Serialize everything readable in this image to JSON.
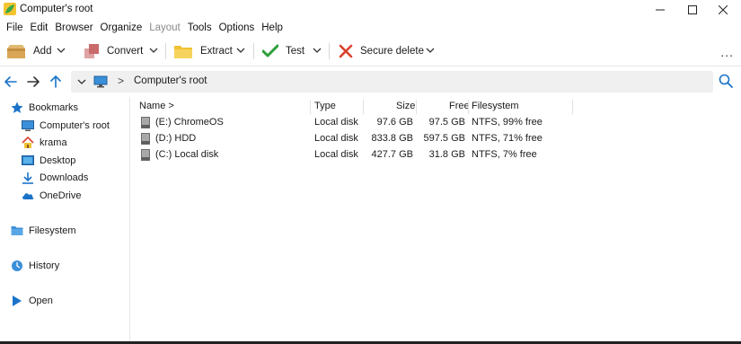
{
  "window": {
    "title": "Computer's root",
    "controls": [
      "minimize-icon",
      "maximize-icon",
      "close-icon"
    ]
  },
  "menu": [
    {
      "label": "File",
      "enabled": true
    },
    {
      "label": "Edit",
      "enabled": true
    },
    {
      "label": "Browser",
      "enabled": true
    },
    {
      "label": "Organize",
      "enabled": true
    },
    {
      "label": "Layout",
      "enabled": false
    },
    {
      "label": "Tools",
      "enabled": true
    },
    {
      "label": "Options",
      "enabled": true
    },
    {
      "label": "Help",
      "enabled": true
    }
  ],
  "toolbar": {
    "add": {
      "label": "Add",
      "icon": "archive-add-icon"
    },
    "convert": {
      "label": "Convert",
      "icon": "convert-icon"
    },
    "extract": {
      "label": "Extract",
      "icon": "folder-extract-icon"
    },
    "test": {
      "label": "Test",
      "icon": "checkmark-icon"
    },
    "secure_delete": {
      "label": "Secure delete",
      "icon": "x-delete-icon"
    },
    "more": "..."
  },
  "navigation": {
    "back_icon": "arrow-left-icon",
    "forward_icon": "arrow-right-icon",
    "up_icon": "arrow-up-icon",
    "separator": ">",
    "location": "Computer's root",
    "search_icon": "search-icon"
  },
  "sidebar": {
    "bookmarks": {
      "label": "Bookmarks",
      "icon": "star-icon"
    },
    "bookmark_items": [
      {
        "label": "Computer's root",
        "icon": "monitor-icon"
      },
      {
        "label": "krama",
        "icon": "home-icon"
      },
      {
        "label": "Desktop",
        "icon": "desktop-icon"
      },
      {
        "label": "Downloads",
        "icon": "download-icon"
      },
      {
        "label": "OneDrive",
        "icon": "cloud-icon"
      }
    ],
    "filesystem": {
      "label": "Filesystem",
      "icon": "folder-icon"
    },
    "history": {
      "label": "History",
      "icon": "history-icon"
    },
    "open": {
      "label": "Open",
      "icon": "play-icon"
    }
  },
  "filelist": {
    "columns": {
      "name": "Name >",
      "type": "Type",
      "size": "Size",
      "free": "Free",
      "filesystem": "Filesystem"
    },
    "rows": [
      {
        "name": "(E:) ChromeOS",
        "type": "Local disk",
        "size": "97.6 GB",
        "free": "97.5 GB",
        "filesystem": "NTFS, 99% free"
      },
      {
        "name": "(D:) HDD",
        "type": "Local disk",
        "size": "833.8 GB",
        "free": "597.5 GB",
        "filesystem": "NTFS, 71% free"
      },
      {
        "name": "(C:) Local disk",
        "type": "Local disk",
        "size": "427.7 GB",
        "free": "31.8 GB",
        "filesystem": "NTFS, 7% free"
      }
    ]
  },
  "colors": {
    "accent": "#1a73c9",
    "check_green": "#2e9e3a",
    "delete_red": "#d9442f",
    "folder_yellow": "#f1c232"
  }
}
